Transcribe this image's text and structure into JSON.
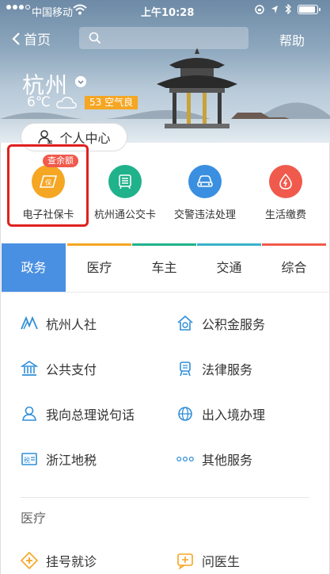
{
  "status_bar": {
    "carrier": "中国移动",
    "time": "上午10:28"
  },
  "nav": {
    "back_label": "首页",
    "help_label": "帮助"
  },
  "weather": {
    "city": "杭州",
    "temperature": "6℃",
    "aqi": "53 空气良",
    "aqi_color": "#f5a623"
  },
  "personal_center": "个人中心",
  "quick_services": [
    {
      "label": "电子社保卡",
      "color": "#f5a623",
      "icon": "social-security-card-icon",
      "badge": "查余额"
    },
    {
      "label": "杭州通公交卡",
      "color": "#20b28a",
      "icon": "bus-card-icon"
    },
    {
      "label": "交警违法处理",
      "color": "#3a8fe0",
      "icon": "car-icon"
    },
    {
      "label": "生活缴费",
      "color": "#f05a4c",
      "icon": "utility-drop-icon"
    }
  ],
  "category_tabs": [
    {
      "label": "政务",
      "active": true,
      "bar_color": "#4a90e2"
    },
    {
      "label": "医疗",
      "bar_color": "#f5a623"
    },
    {
      "label": "车主",
      "bar_color": "#20b28a"
    },
    {
      "label": "交通",
      "bar_color": "#3ab2c8"
    },
    {
      "label": "综合",
      "bar_color": "#f05a4c"
    }
  ],
  "government_services": [
    {
      "label": "杭州人社",
      "icon": "hr-icon"
    },
    {
      "label": "公积金服务",
      "icon": "housing-fund-icon"
    },
    {
      "label": "公共支付",
      "icon": "public-payment-icon"
    },
    {
      "label": "法律服务",
      "icon": "legal-icon"
    },
    {
      "label": "我向总理说句话",
      "icon": "premier-message-icon"
    },
    {
      "label": "出入境办理",
      "icon": "globe-icon"
    },
    {
      "label": "浙江地税",
      "icon": "tax-icon"
    },
    {
      "label": "其他服务",
      "icon": "more-dots-icon"
    }
  ],
  "medical_section": {
    "title": "医疗",
    "items": [
      {
        "label": "挂号就诊",
        "icon": "registration-icon"
      },
      {
        "label": "问医生",
        "icon": "ask-doctor-icon"
      }
    ]
  },
  "icon_color": "#2f8fd8"
}
